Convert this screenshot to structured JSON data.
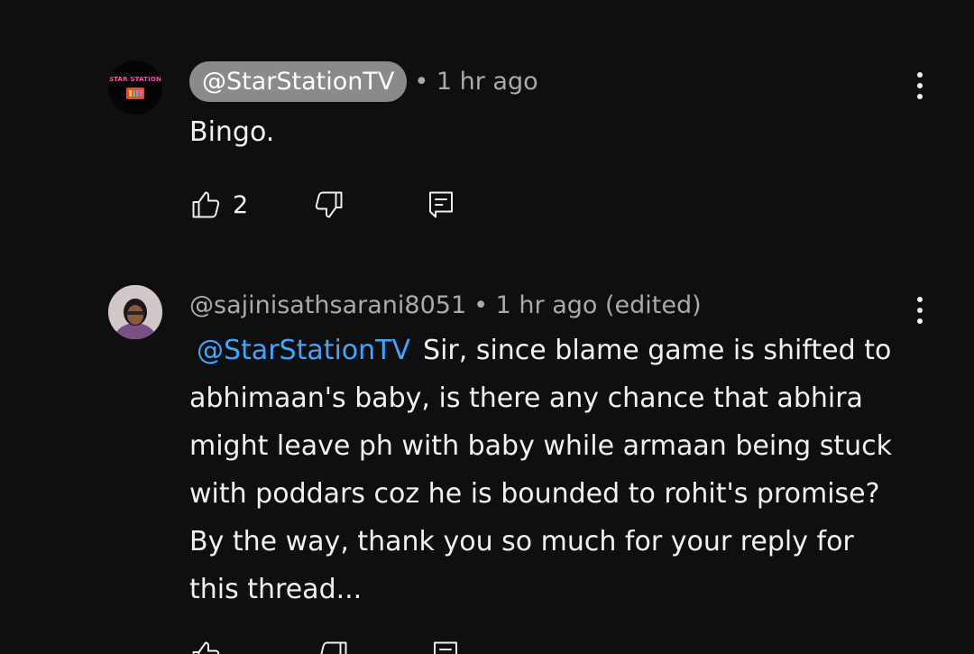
{
  "comments": [
    {
      "author": "@StarStationTV",
      "meta": "• 1 hr ago",
      "text": "Bingo.",
      "like_count": "2",
      "avatar_label": "STAR STATION",
      "icons": {
        "like": "thumb-up-icon",
        "dislike": "thumb-down-icon",
        "reply": "reply-comment-icon",
        "menu": "more-vert-icon"
      }
    },
    {
      "author": "@sajinisathsarani8051",
      "meta": "• 1 hr ago (edited)",
      "mention": "@StarStationTV",
      "text": "Sir, since blame game is shifted to abhimaan's baby, is there any chance that abhira might leave ph with baby while armaan being stuck with poddars coz he is bounded to rohit's promise? By the way, thank you so much for your reply for this thread...",
      "icons": {
        "like": "thumb-up-icon",
        "dislike": "thumb-down-icon",
        "reply": "reply-comment-icon",
        "menu": "more-vert-icon"
      }
    }
  ],
  "colors": {
    "background": "#0f0f0f",
    "text": "#f1f1f1",
    "meta": "#aaaaaa",
    "mention": "#3ea6ff",
    "author_pill": "#8a8a8a"
  }
}
